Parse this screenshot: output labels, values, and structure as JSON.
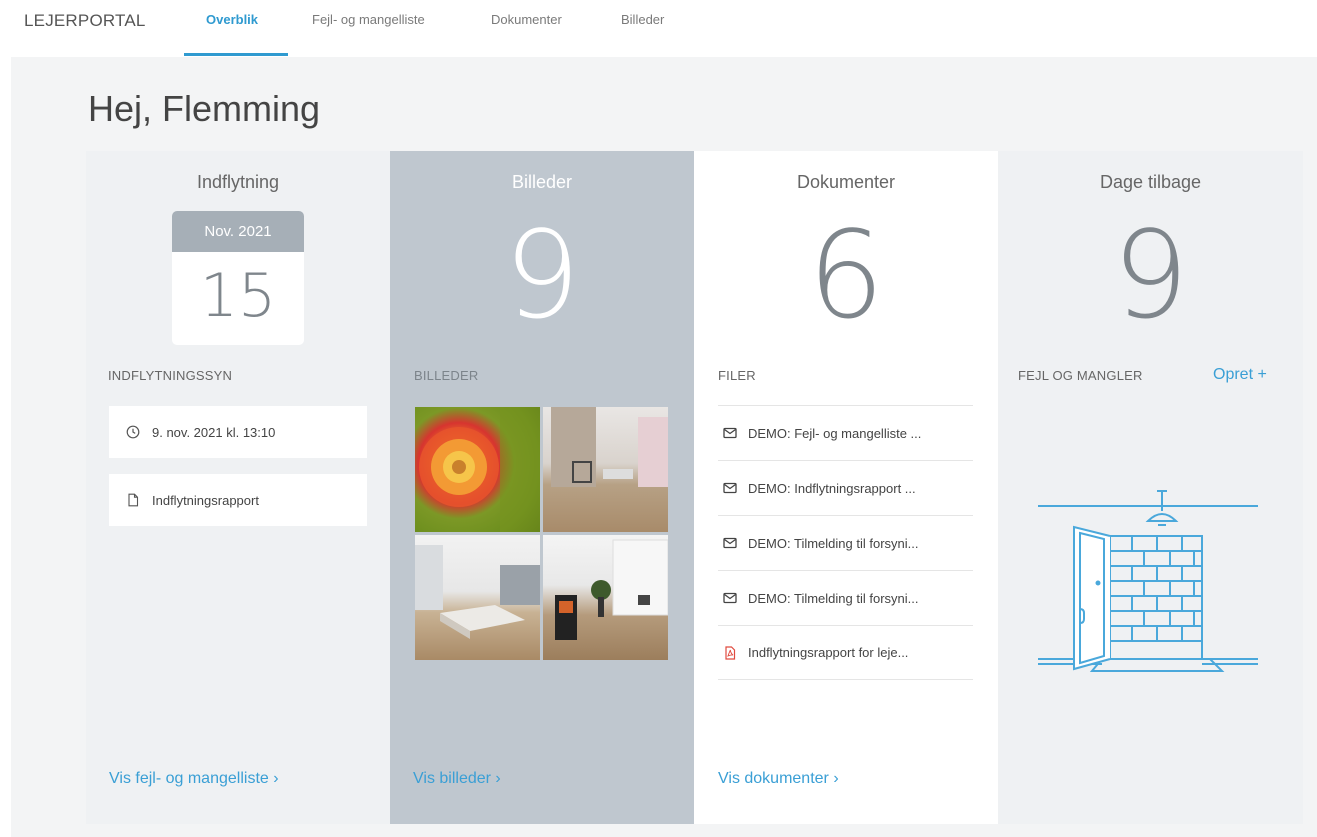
{
  "nav": {
    "brand": "LEJERPORTAL",
    "tabs": [
      {
        "label": "Overblik",
        "active": true
      },
      {
        "label": "Fejl- og mangelliste",
        "active": false
      },
      {
        "label": "Dokumenter",
        "active": false
      },
      {
        "label": "Billeder",
        "active": false
      }
    ]
  },
  "greeting": "Hej, Flemming",
  "columns": {
    "move_in": {
      "title": "Indflytning",
      "calendar_month": "Nov. 2021",
      "calendar_day": "15",
      "section_label": "INDFLYTNINGSSYN",
      "appointment": "9. nov. 2021 kl. 13:10",
      "report": "Indflytningsrapport",
      "footer_link": "Vis fejl- og mangelliste ›"
    },
    "photos": {
      "title": "Billeder",
      "count": "9",
      "section_label": "BILLEDER",
      "footer_link": "Vis billeder ›"
    },
    "documents": {
      "title": "Dokumenter",
      "count": "6",
      "section_label": "FILER",
      "files": [
        {
          "name": "DEMO: Fejl- og mangelliste ...",
          "icon": "mail-icon"
        },
        {
          "name": "DEMO: Indflytningsrapport ...",
          "icon": "mail-icon"
        },
        {
          "name": "DEMO: Tilmelding til forsyni...",
          "icon": "mail-icon"
        },
        {
          "name": "DEMO: Tilmelding til forsyni...",
          "icon": "mail-icon"
        },
        {
          "name": "Indflytningsrapport for leje...",
          "icon": "pdf-icon"
        }
      ],
      "footer_link": "Vis dokumenter ›"
    },
    "days_left": {
      "title": "Dage tilbage",
      "count": "9",
      "section_label": "FEJL OG MANGLER",
      "create_link": "Opret +"
    }
  },
  "colors": {
    "accent": "#3a9fd5",
    "photos_column_bg": "#bfc7cf",
    "calendar_header": "#a6afb7",
    "pdf_icon": "#e04a3f"
  }
}
